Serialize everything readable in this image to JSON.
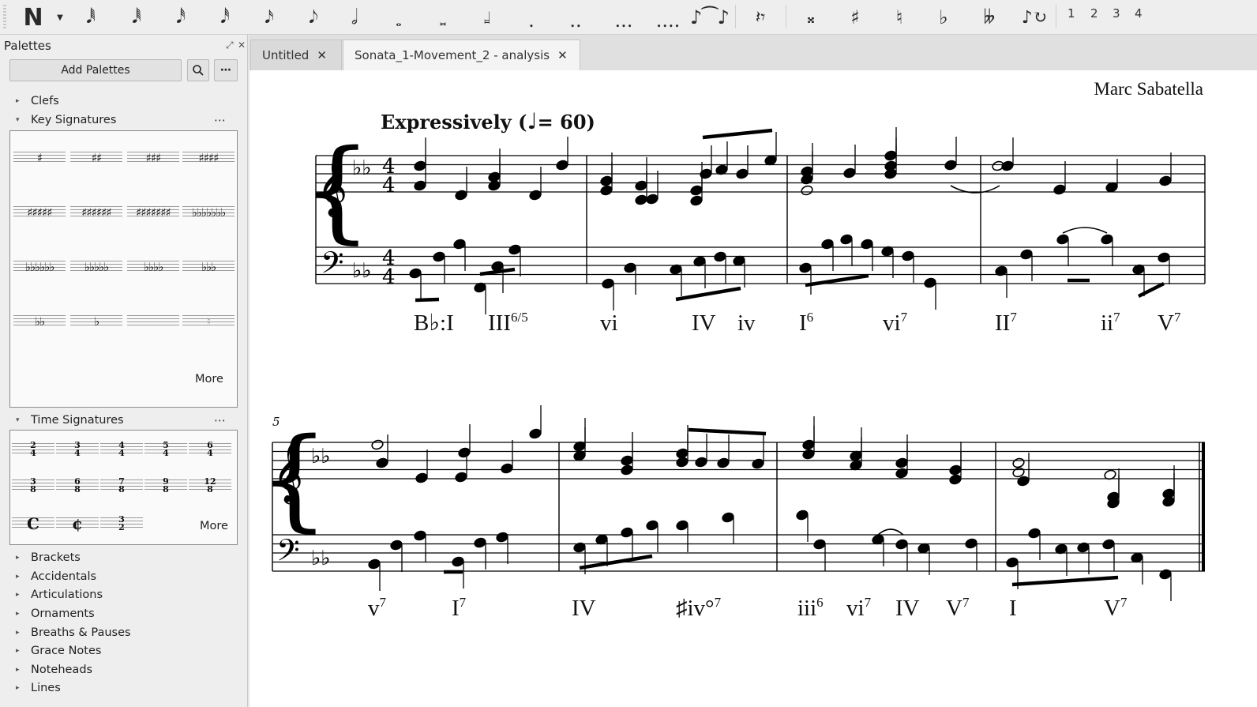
{
  "toolbar": {
    "note_input_label": "N",
    "durations": [
      "1024th",
      "512th",
      "256th",
      "128th",
      "64th",
      "32nd",
      "16th",
      "8th",
      "quarter",
      "half",
      "whole",
      "breve",
      "longa",
      "augmentation-dot",
      "double-dot",
      "triple-dot",
      "quadruple-dot"
    ],
    "voices": [
      "1",
      "2",
      "3",
      "4"
    ]
  },
  "palettes": {
    "title": "Palettes",
    "add_button": "Add Palettes",
    "sections": {
      "clefs": "Clefs",
      "key_signatures": "Key Signatures",
      "time_signatures": "Time Signatures",
      "brackets": "Brackets",
      "accidentals": "Accidentals",
      "articulations": "Articulations",
      "ornaments": "Ornaments",
      "breaths": "Breaths & Pauses",
      "grace_notes": "Grace Notes",
      "noteheads": "Noteheads",
      "lines": "Lines"
    },
    "key_sigs": [
      "♯",
      "♯♯",
      "♯♯♯",
      "♯♯♯♯",
      "♯♯♯♯♯",
      "♯♯♯♯♯♯",
      "♯♯♯♯♯♯♯",
      "♭♭♭♭♭♭♭",
      "♭♭♭♭♭♭",
      "♭♭♭♭♭",
      "♭♭♭♭",
      "♭♭♭",
      "♭♭",
      "♭",
      "",
      "♮"
    ],
    "time_sigs": [
      {
        "top": "2",
        "bottom": "4"
      },
      {
        "top": "3",
        "bottom": "4"
      },
      {
        "top": "4",
        "bottom": "4"
      },
      {
        "top": "5",
        "bottom": "4"
      },
      {
        "top": "6",
        "bottom": "4"
      },
      {
        "top": "3",
        "bottom": "8"
      },
      {
        "top": "6",
        "bottom": "8"
      },
      {
        "top": "7",
        "bottom": "8"
      },
      {
        "top": "9",
        "bottom": "8"
      },
      {
        "top": "12",
        "bottom": "8"
      },
      {
        "top": "C",
        "bottom": ""
      },
      {
        "top": "¢",
        "bottom": ""
      },
      {
        "top": "3",
        "bottom": "2"
      }
    ],
    "more_label": "More"
  },
  "tabs": [
    {
      "label": "Untitled"
    },
    {
      "label": "Sonata_1-Movement_2 - analysis"
    }
  ],
  "score": {
    "composer": "Marc Sabatella",
    "tempo_text": "Expressively (",
    "tempo_value": "= 60)",
    "measure_number": "5",
    "analysis_row1": [
      {
        "base": "B♭:I",
        "sup": ""
      },
      {
        "base": "III",
        "sup": "6/5"
      },
      {
        "base": "vi",
        "sup": ""
      },
      {
        "base": "IV",
        "sup": ""
      },
      {
        "base": "iv",
        "sup": ""
      },
      {
        "base": "I",
        "sup": "6"
      },
      {
        "base": "vi",
        "sup": "7"
      },
      {
        "base": "II",
        "sup": "7"
      },
      {
        "base": "ii",
        "sup": "7"
      },
      {
        "base": "V",
        "sup": "7"
      }
    ],
    "analysis_row2": [
      {
        "base": "v",
        "sup": "7"
      },
      {
        "base": "I",
        "sup": "7"
      },
      {
        "base": "IV",
        "sup": ""
      },
      {
        "base": "♯iv°",
        "sup": "7"
      },
      {
        "base": "iii",
        "sup": "6"
      },
      {
        "base": "vi",
        "sup": "7"
      },
      {
        "base": "IV",
        "sup": ""
      },
      {
        "base": "V",
        "sup": "7"
      },
      {
        "base": "I",
        "sup": ""
      },
      {
        "base": "V",
        "sup": "7"
      }
    ]
  }
}
